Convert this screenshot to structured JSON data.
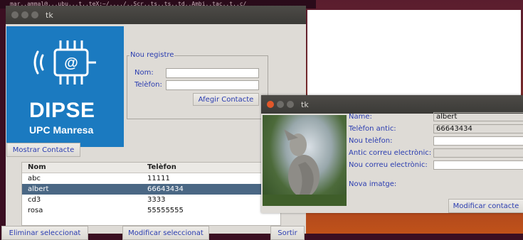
{
  "terminal": {
    "text": "mar..ammal@...ubu...t..teX:~/..../..Scr..ts..ts..td..Ambi..tac..t..c/"
  },
  "main_window": {
    "title": "tk",
    "logo": {
      "title": "DIPSE",
      "subtitle": "UPC Manresa",
      "chip_symbol": "@"
    },
    "new_record": {
      "legend": "Nou registre",
      "name_label": "Nom:",
      "name_value": "",
      "phone_label": "Telèfon:",
      "phone_value": "",
      "add_button": "Afegir Contacte"
    },
    "show_button": "Mostrar Contacte",
    "table": {
      "columns": [
        "Nom",
        "Telèfon"
      ],
      "rows": [
        {
          "name": "abc",
          "phone": "11111"
        },
        {
          "name": "albert",
          "phone": "66643434",
          "selected": true
        },
        {
          "name": "cd3",
          "phone": "3333"
        },
        {
          "name": "rosa",
          "phone": "55555555"
        }
      ]
    },
    "bottom_buttons": {
      "delete": "Eliminar seleccionat",
      "modify": "Modificar seleccionat",
      "exit": "Sortir"
    }
  },
  "edit_window": {
    "title": "tk",
    "fields": {
      "name_label": "Name:",
      "name_value": "albert",
      "old_phone_label": "Telèfon antic:",
      "old_phone_value": "66643434",
      "new_phone_label": "Nou telèfon:",
      "new_phone_value": "",
      "old_email_label": "Antic correu electrònic:",
      "old_email_value": "",
      "new_email_label": "Nou correu electrònic:",
      "new_email_value": "",
      "new_image_label": "Nova imatge:"
    },
    "modify_button": "Modificar contacte"
  },
  "colors": {
    "label_blue": "#2a3cb0",
    "logo_blue": "#1b7ac0",
    "selection": "#4a6784",
    "close_red": "#e2572a"
  }
}
